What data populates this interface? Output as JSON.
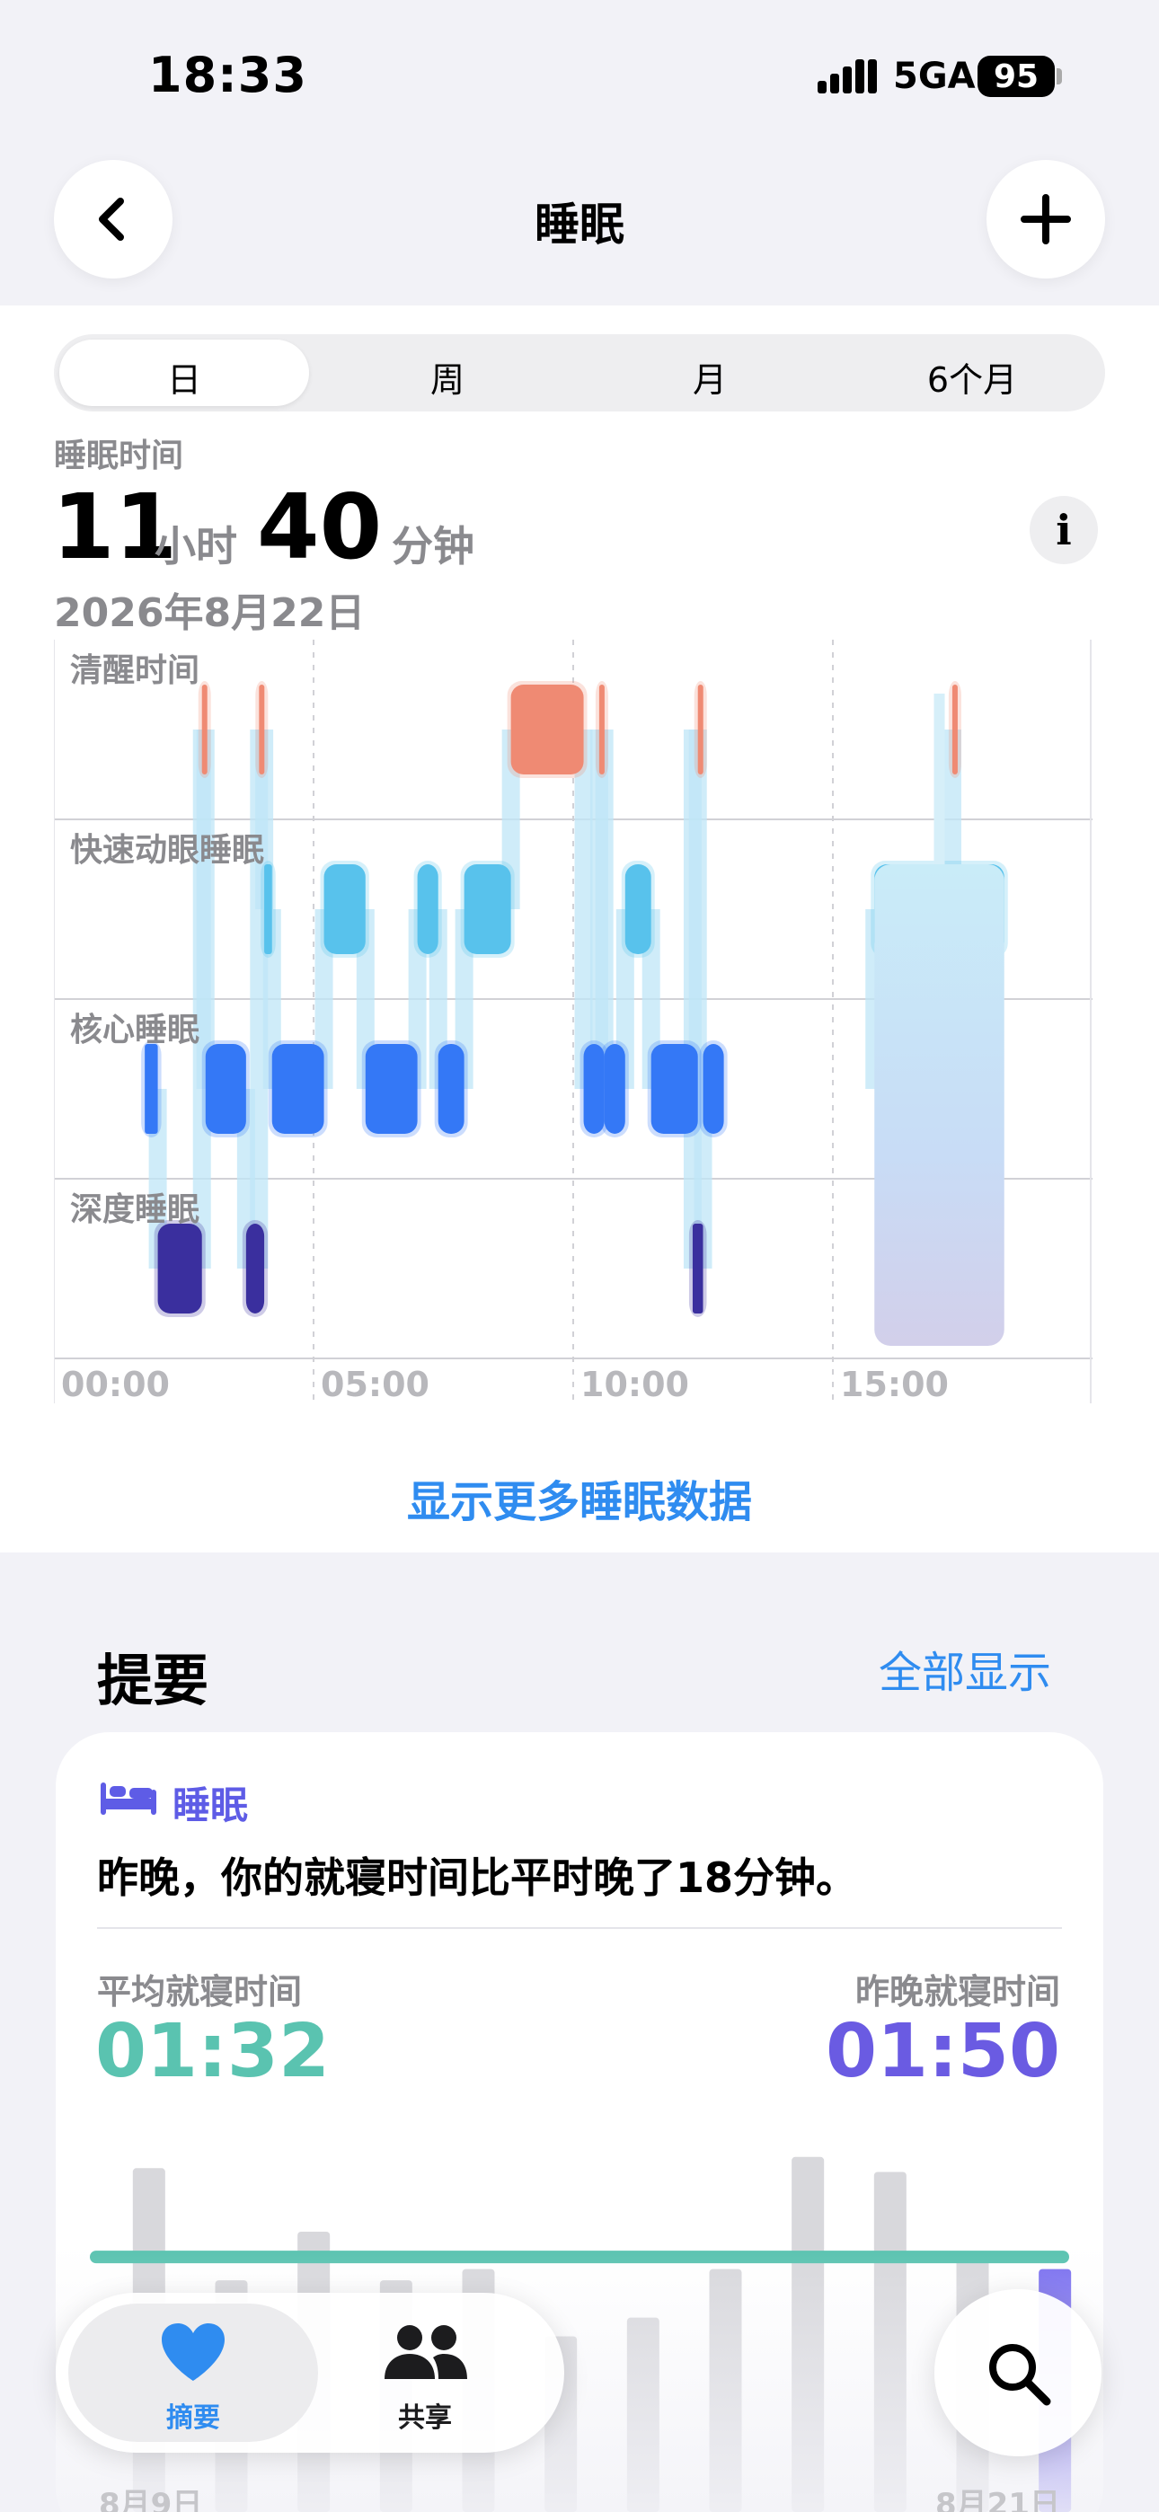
{
  "status": {
    "time": "18:33",
    "network": "5GA",
    "battery": "95"
  },
  "nav": {
    "title": "睡眠"
  },
  "tabs": [
    {
      "label": "日",
      "selected": true
    },
    {
      "label": "周",
      "selected": false
    },
    {
      "label": "月",
      "selected": false
    },
    {
      "label": "6个月",
      "selected": false
    }
  ],
  "summary_header": {
    "label": "睡眠时间",
    "hours": "11",
    "hours_unit": "小时",
    "minutes": "40",
    "minutes_unit": "分钟",
    "date": "2026年8月22日"
  },
  "chart_data": {
    "type": "timeline",
    "stages": [
      "清醒时间",
      "快速动眼睡眠",
      "核心睡眠",
      "深度睡眠"
    ],
    "x_ticks": [
      "00:00",
      "05:00",
      "10:00",
      "15:00"
    ],
    "x_range_hours": [
      0,
      20
    ],
    "stage_colors": {
      "清醒时间": "#ef8a73",
      "快速动眼睡眠": "#58c2ec",
      "核心睡眠": "#3478f6",
      "深度睡眠": "#3a2f9e"
    },
    "segments": [
      {
        "stage": "核心睡眠",
        "start": 1.75,
        "end": 2.0
      },
      {
        "stage": "深度睡眠",
        "start": 2.0,
        "end": 2.85
      },
      {
        "stage": "清醒时间",
        "start": 2.85,
        "end": 2.92
      },
      {
        "stage": "核心睡眠",
        "start": 2.92,
        "end": 3.7
      },
      {
        "stage": "深度睡眠",
        "start": 3.7,
        "end": 4.05
      },
      {
        "stage": "清醒时间",
        "start": 3.95,
        "end": 4.0
      },
      {
        "stage": "快速动眼睡眠",
        "start": 4.05,
        "end": 4.2
      },
      {
        "stage": "核心睡眠",
        "start": 4.2,
        "end": 5.2
      },
      {
        "stage": "快速动眼睡眠",
        "start": 5.2,
        "end": 6.0
      },
      {
        "stage": "核心睡眠",
        "start": 6.0,
        "end": 7.0
      },
      {
        "stage": "快速动眼睡眠",
        "start": 7.0,
        "end": 7.4
      },
      {
        "stage": "核心睡眠",
        "start": 7.4,
        "end": 7.9
      },
      {
        "stage": "快速动眼睡眠",
        "start": 7.9,
        "end": 8.8
      },
      {
        "stage": "清醒时间",
        "start": 8.8,
        "end": 10.2
      },
      {
        "stage": "核心睡眠",
        "start": 10.2,
        "end": 10.6
      },
      {
        "stage": "清醒时间",
        "start": 10.5,
        "end": 10.6
      },
      {
        "stage": "核心睡眠",
        "start": 10.6,
        "end": 11.0
      },
      {
        "stage": "快速动眼睡眠",
        "start": 11.0,
        "end": 11.5
      },
      {
        "stage": "核心睡眠",
        "start": 11.5,
        "end": 12.4
      },
      {
        "stage": "清醒时间",
        "start": 12.4,
        "end": 12.5
      },
      {
        "stage": "深度睡眠",
        "start": 12.3,
        "end": 12.5
      },
      {
        "stage": "核心睡眠",
        "start": 12.5,
        "end": 12.9
      },
      {
        "stage": "快速动眼睡眠",
        "start": 15.8,
        "end": 18.3
      },
      {
        "stage": "清醒时间",
        "start": 17.3,
        "end": 17.4
      }
    ]
  },
  "more_link": "显示更多睡眠数据",
  "highlights": {
    "title": "提要",
    "show_all": "全部显示",
    "card": {
      "category": "睡眠",
      "message": "昨晚，你的就寝时间比平时晚了18分钟。",
      "avg_label": "平均就寝时间",
      "avg_value": "01:32",
      "last_label": "昨晚就寝时间",
      "last_value": "01:50",
      "colors": {
        "avg": "#5ac3b0",
        "last": "#6a5be2"
      }
    },
    "bedtime_chart": {
      "type": "bar",
      "start_label": "8月9日",
      "end_label": "8月21日",
      "relative_heights": [
        0.92,
        0.62,
        0.75,
        0.62,
        0.65,
        0.47,
        0.52,
        0.65,
        0.95,
        0.91,
        0.68,
        0.65
      ],
      "average_line": 0.68
    }
  },
  "tabbar": {
    "summary": "摘要",
    "sharing": "共享"
  }
}
